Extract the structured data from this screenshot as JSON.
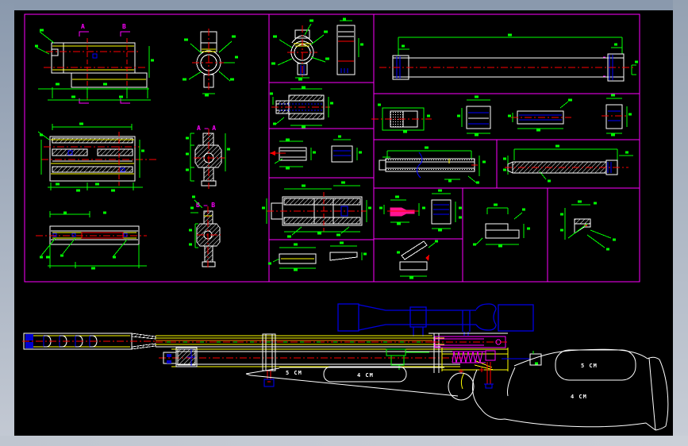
{
  "window": {
    "type": "cad-drawing-viewer",
    "canvas_bg": "#000000",
    "frame_style": "beveled-gray"
  },
  "colors": {
    "frame_top": "#8a99ad",
    "frame_bottom": "#c9ced7",
    "panel_border": "#ff00ff",
    "dimension_green": "#00ff00",
    "outline_white": "#ffffff",
    "centerline_red": "#ff0000",
    "detail_yellow": "#ffff00",
    "detail_blue": "#0000ff",
    "scope_blue": "#0000e0",
    "pin_pink": "#ff1493",
    "barrel_orange": "#ff8000"
  },
  "sheet": {
    "type": "multiview-part-drawings",
    "section_labels": {
      "a": "A",
      "b": "B",
      "aa": "A — A",
      "bb": "B — B"
    }
  },
  "assembly": {
    "description": "air rifle side view with scope",
    "forend_labels": [
      "5 CM",
      "4 CM"
    ],
    "stock_labels": [
      "5 CM",
      "4 CM"
    ]
  }
}
